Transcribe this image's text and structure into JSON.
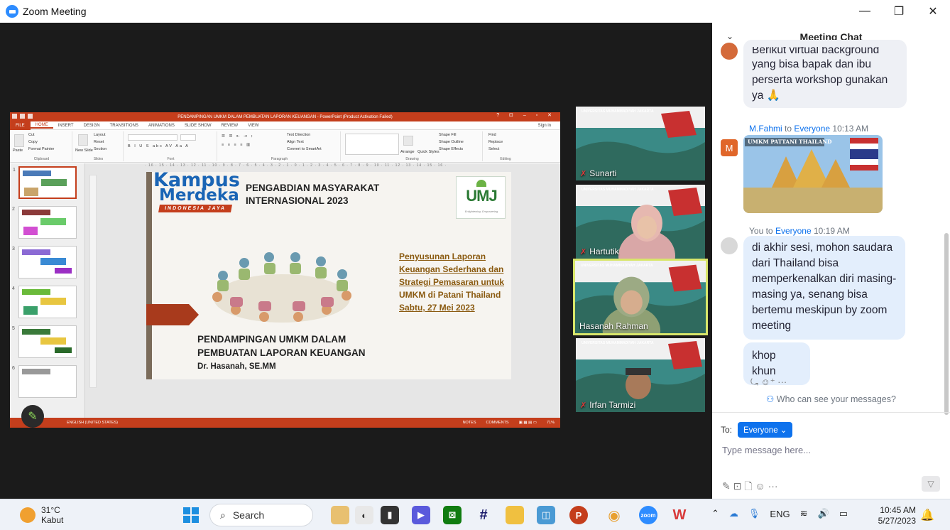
{
  "window": {
    "title": "Zoom Meeting",
    "minimize": "—",
    "restore": "❐",
    "close": "✕"
  },
  "ppt": {
    "title_bar": "PENDAMPINGAN UMKM DALAM PEMBUATAN LAPORAN KEUANGAN - PowerPoint (Product Activation Failed)",
    "tabs": [
      "FILE",
      "HOME",
      "INSERT",
      "DESIGN",
      "TRANSITIONS",
      "ANIMATIONS",
      "SLIDE SHOW",
      "REVIEW",
      "VIEW"
    ],
    "sign_in": "Sign in",
    "ribbon_groups": [
      "Clipboard",
      "Slides",
      "Font",
      "Paragraph",
      "Drawing",
      "Editing"
    ],
    "clipboard_items": [
      "Cut",
      "Copy",
      "Format Painter",
      "Paste"
    ],
    "slides_items": [
      "Layout",
      "Reset",
      "Section",
      "New Slide"
    ],
    "paragraph_items": [
      "Text Direction",
      "Align Text",
      "Convert to SmartArt"
    ],
    "drawing_items": [
      "Shape Fill",
      "Shape Outline",
      "Shape Effects",
      "Arrange",
      "Quick Styles"
    ],
    "editing_items": [
      "Find",
      "Replace",
      "Select"
    ],
    "ruler": "· 16 · 15 · 14 · 13 · 12 · 11 · 10 · 9 · 8 · 7 · 6 · 5 · 4 · 3 · 2 · 1 · 0 · 1 · 2 · 3 · 4 · 5 · 6 · 7 · 8 · 9 · 10 · 11 · 12 · 13 · 14 · 15 · 16 ·",
    "thumb_numbers": [
      "1",
      "2",
      "3",
      "4",
      "5",
      "6"
    ],
    "status_language": "ENGLISH (UNITED STATES)",
    "status_notes": "NOTES",
    "status_comments": "COMMENTS",
    "status_zoom": "71%",
    "accent": "#C43E1C"
  },
  "slide": {
    "kampus_line1": "Kampus",
    "kampus_line2": "Merdeka",
    "kampus_badge": "INDONESIA JAYA",
    "heading_line1": "PENGABDIAN MASYARAKAT",
    "heading_line2": "INTERNASIONAL 2023",
    "umj_logo": "UMJ",
    "umj_tagline": "Enlightening, Empowering",
    "right_lines": [
      "Penyusunan Laporan",
      "Keuangan Sederhana dan",
      "Strategi Pemasaran untuk",
      "UMKM di Patani Thailand",
      "Sabtu, 27 Mei 2023"
    ],
    "main_line1": "PENDAMPINGAN UMKM DALAM",
    "main_line2": "PEMBUATAN LAPORAN KEUANGAN",
    "presenter": "Dr. Hasanah, SE.MM"
  },
  "participants": [
    {
      "name": "Sunarti",
      "muted": true
    },
    {
      "name": "Hartutik",
      "muted": true
    },
    {
      "name": "Hasanah Rahman",
      "muted": false,
      "active": true
    },
    {
      "name": "Irfan Tarmizi",
      "muted": true
    }
  ],
  "tile_banner": "UNIVERSITAS MUHAMMADIYAH JAKARTA",
  "chat": {
    "title": "Meeting Chat",
    "msg1_lines": [
      "Berikut virtual background",
      "yang bisa bapak dan ibu",
      "perserta workshop gunakan",
      "ya 🙏"
    ],
    "msg2_from": "M.Fahmi",
    "msg2_to_word": "to",
    "msg2_to": "Everyone",
    "msg2_time": "10:13 AM",
    "msg2_image_caption": "UMKM PATTANI THAILAND",
    "msg3_from": "You",
    "msg3_to_word": "to",
    "msg3_to": "Everyone",
    "msg3_time": "10:19 AM",
    "msg3_text": "di akhir sesi, mohon saudara dari Thailand bisa memperkenalkan diri masing-masing ya, senang bisa bertemu meskipun by zoom meeting",
    "msg4_text": "khop khun",
    "reactions": "⤿  ☺⁺  ···",
    "who_can_see": "Who can see your messages?",
    "to_label": "To:",
    "to_value": "Everyone ⌄",
    "placeholder": "Type message here...",
    "tools": "✎  ⊡  🗋  ☺  ···",
    "avatar_m": "M"
  },
  "taskbar": {
    "temperature": "31°C",
    "weather": "Kabut",
    "search": "Search",
    "tray_lang": "ENG",
    "time": "10:45 AM",
    "date": "5/27/2023"
  }
}
